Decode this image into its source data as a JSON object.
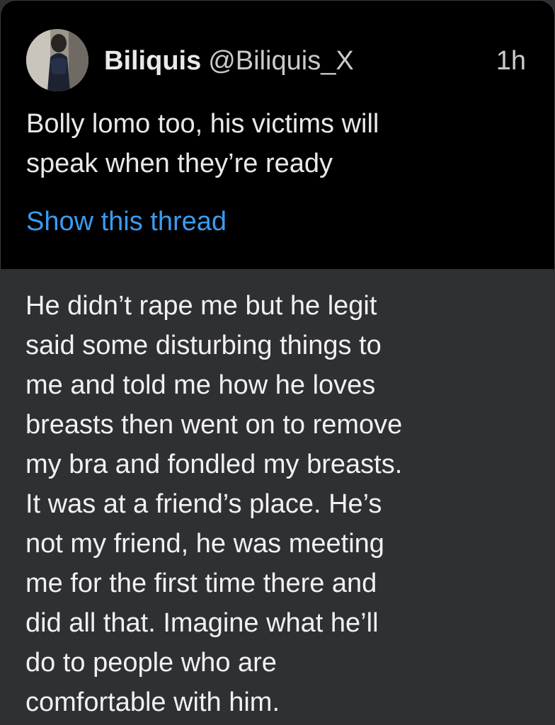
{
  "tweet": {
    "author_name": "Biliquis",
    "author_handle": "@Biliquis_X",
    "timestamp": "1h",
    "text_lines": [
      "Bolly lomo too, his victims will",
      "speak when they’re ready"
    ],
    "show_thread_label": "Show this thread",
    "link_color": "#3a9bf0"
  },
  "reply": {
    "lines": [
      "He didn’t rape me but he legit",
      "said some disturbing things to",
      "me and told me how he loves",
      "breasts then went on to remove",
      "my bra and fondled my breasts.",
      "It was at a friend’s place. He’s",
      "not my friend, he was meeting",
      "me for the first time there and",
      "did all that. Imagine what he’ll",
      "do to people who are",
      "comfortable with him."
    ]
  },
  "colors": {
    "card_background": "#000000",
    "panel_background": "#2f3033"
  }
}
